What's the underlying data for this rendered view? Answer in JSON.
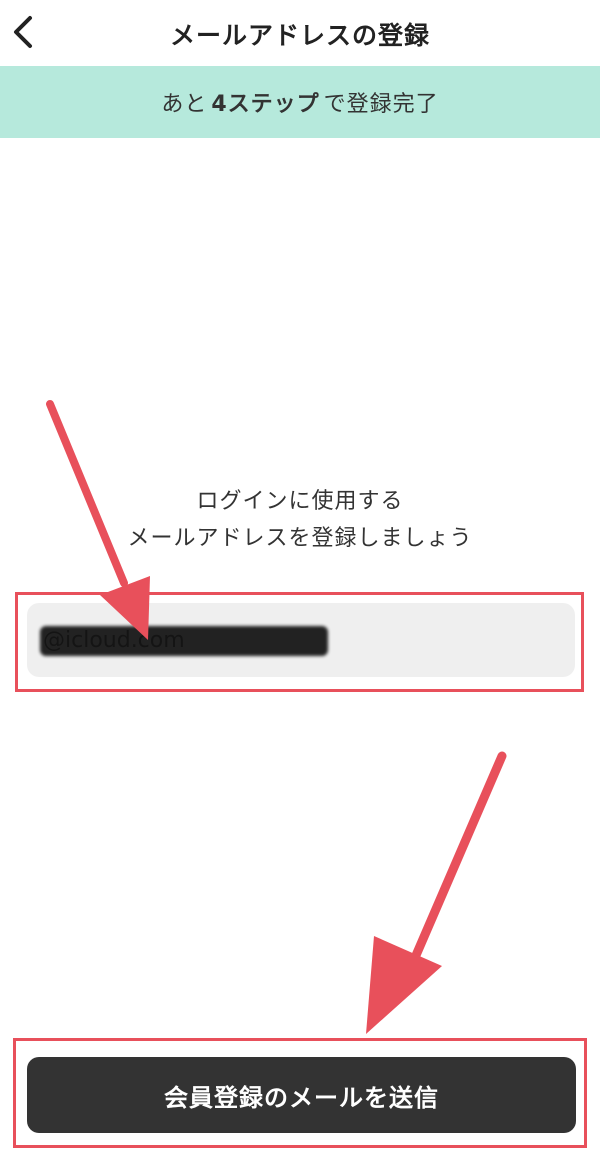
{
  "header": {
    "back_icon": "chevron-left-icon",
    "title": "メールアドレスの登録"
  },
  "step_banner": {
    "prefix": "あと",
    "count": "4ステップ",
    "suffix": "で登録完了",
    "background": "#b6e9dc"
  },
  "prompt": {
    "line1": "ログインに使用する",
    "line2": "メールアドレスを登録しましょう"
  },
  "email_field": {
    "value": "@icloud.com",
    "redacted": true
  },
  "submit": {
    "label": "会員登録のメールを送信",
    "background": "#333333"
  },
  "annotations": {
    "color": "#e8505b"
  }
}
